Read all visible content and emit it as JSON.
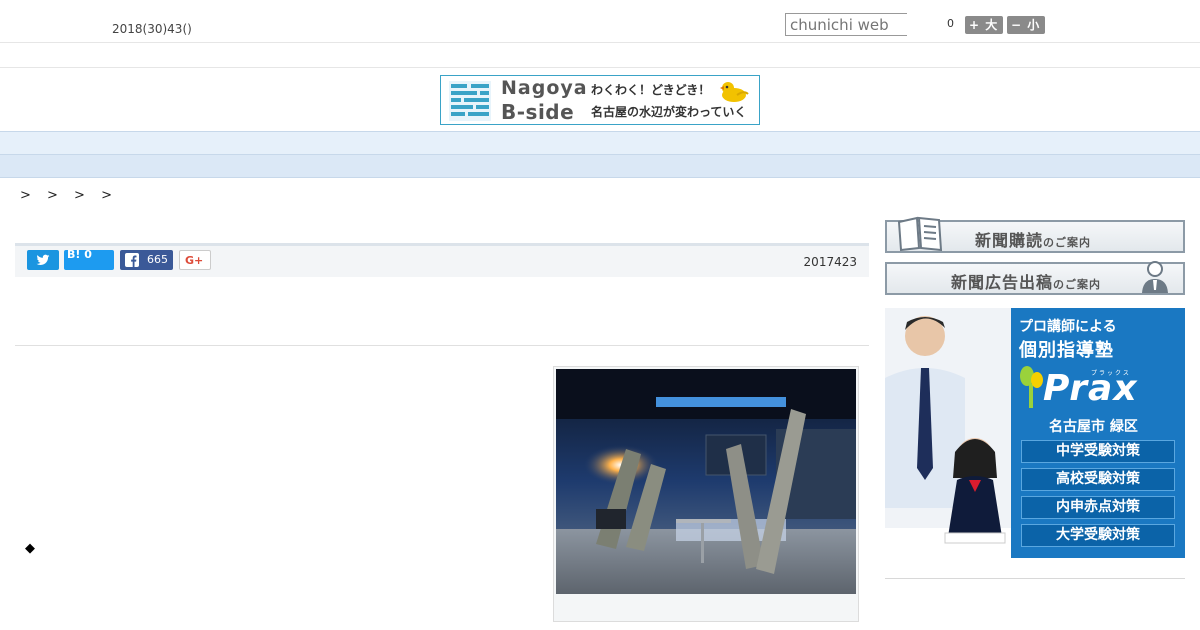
{
  "header": {
    "date": "2018(30)43()",
    "search_placeholder": "chunichi web",
    "font_size_counter": "0",
    "font_large_label": "+ 大",
    "font_small_label": "− 小"
  },
  "banner": {
    "word1": "Nagoya",
    "word2": "B-side",
    "tagline1": "わくわく！どきどき！",
    "tagline2": "名古屋の水辺が変わっていく",
    "brand_color": "#3aa3c7"
  },
  "nav": {
    "items": [
      "",
      "",
      "",
      "",
      "",
      "",
      "",
      "",
      ""
    ]
  },
  "breadcrumb": ">   > > >",
  "article": {
    "share": {
      "hatena_label": "B!",
      "hatena_count": "0",
      "facebook_count": "665",
      "gplus_label": "G+"
    },
    "date": "2017423",
    "bullet": "◆"
  },
  "sidebar": {
    "subscribe": {
      "main": "新聞購読",
      "note": "のご案内"
    },
    "advertise": {
      "main": "新聞広告出稿",
      "note": "のご案内"
    },
    "prax_ad": {
      "headline1": "プロ講師による",
      "headline2": "個別指導塾",
      "ruby": "プラックス",
      "logo": "Prax",
      "location": "名古屋市 緑区",
      "items": [
        "中学受験対策",
        "高校受験対策",
        "内申赤点対策",
        "大学受験対策"
      ]
    }
  },
  "colors": {
    "nav_bg": "#e6f0fa",
    "subnav_bg": "#dbe8f6",
    "twitter": "#1b95e0",
    "facebook": "#3b5998",
    "gplus": "#dd4b39",
    "prax_blue": "#1a78c2"
  }
}
